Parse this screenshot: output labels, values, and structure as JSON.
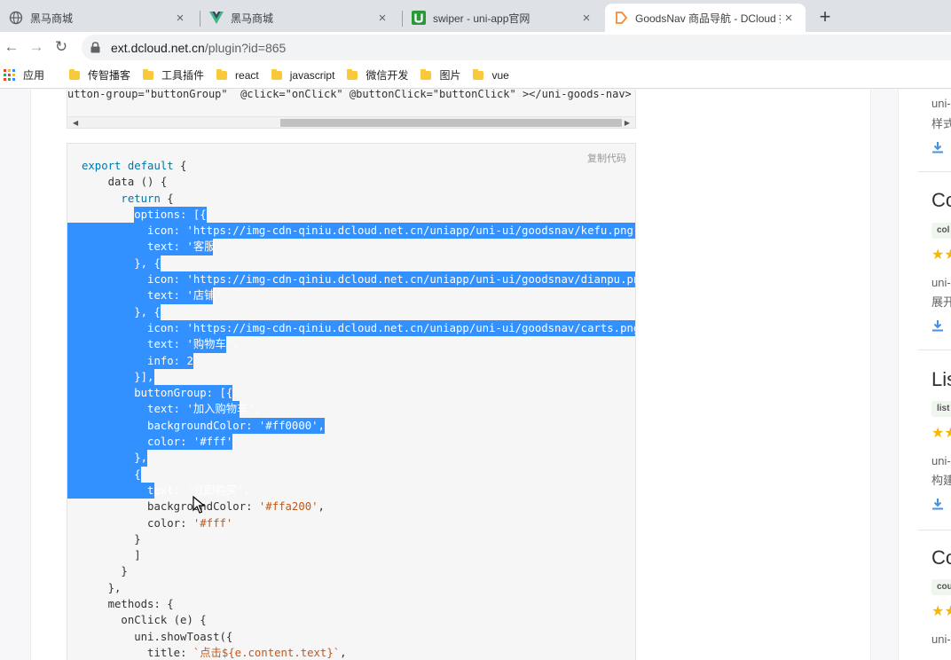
{
  "tabs": [
    {
      "title": "黑马商城",
      "icon": "globe-icon",
      "close": "×"
    },
    {
      "title": "黑马商城",
      "icon": "vue-logo-icon",
      "close": "×"
    },
    {
      "title": "swiper - uni-app官网",
      "icon": "uni-app-logo-icon",
      "close": "×"
    },
    {
      "title": "GoodsNav 商品导航 - DCloud 插",
      "icon": "dcloud-logo-icon",
      "close": "×"
    }
  ],
  "new_tab": "+",
  "toolbar": {
    "back": "←",
    "forward": "→",
    "reload": "↻",
    "url_host": "ext.dcloud.net.cn",
    "url_path": "/plugin?id=865"
  },
  "bookmarks": {
    "apps": "应用",
    "items": [
      "传智播客",
      "工具插件",
      "react",
      "javascript",
      "微信开发",
      "图片",
      "vue"
    ]
  },
  "top_code_line": "utton-group=\"buttonGroup\"  @click=\"onClick\" @buttonClick=\"buttonClick\" ></uni-goods-nav>",
  "scroll": {
    "left": "◀",
    "right": "▶"
  },
  "copy_label": "复制代码",
  "code_lines": [
    {
      "indent": "",
      "text": "export default {"
    },
    {
      "indent": "    ",
      "text": "data () {"
    },
    {
      "indent": "      ",
      "text": "return {"
    },
    {
      "indent": "        ",
      "text": "options: [{"
    },
    {
      "indent": "          ",
      "text": "icon: 'https://img-cdn-qiniu.dcloud.net.cn/uniapp/uni-ui/goodsnav/kefu.png',"
    },
    {
      "indent": "          ",
      "text": "text: '客服'"
    },
    {
      "indent": "        ",
      "text": "}, {"
    },
    {
      "indent": "          ",
      "text": "icon: 'https://img-cdn-qiniu.dcloud.net.cn/uniapp/uni-ui/goodsnav/dianpu.png',"
    },
    {
      "indent": "          ",
      "text": "text: '店铺'"
    },
    {
      "indent": "        ",
      "text": "}, {"
    },
    {
      "indent": "          ",
      "text": "icon: 'https://img-cdn-qiniu.dcloud.net.cn/uniapp/uni-ui/goodsnav/carts.png',"
    },
    {
      "indent": "          ",
      "text": "text: '购物车',"
    },
    {
      "indent": "          ",
      "text": "info: 2"
    },
    {
      "indent": "        ",
      "text": "}],"
    },
    {
      "indent": "        ",
      "text": "buttonGroup: [{"
    },
    {
      "indent": "          ",
      "text": "text: '加入购物车',"
    },
    {
      "indent": "          ",
      "text": "backgroundColor: '#ff0000',"
    },
    {
      "indent": "          ",
      "text": "color: '#fff'"
    },
    {
      "indent": "        ",
      "text": "},"
    },
    {
      "indent": "        ",
      "text": "{"
    },
    {
      "indent": "          ",
      "text": "text: '立即购买',"
    },
    {
      "indent": "          ",
      "text": "backgroundColor: '#ffa200',"
    },
    {
      "indent": "          ",
      "text": "color: '#fff'"
    },
    {
      "indent": "        ",
      "text": "}"
    },
    {
      "indent": "        ",
      "text": "]"
    },
    {
      "indent": "      ",
      "text": "}"
    },
    {
      "indent": "    ",
      "text": "},"
    },
    {
      "indent": "    ",
      "text": "methods: {"
    },
    {
      "indent": "      ",
      "text": "onClick (e) {"
    },
    {
      "indent": "        ",
      "text": "uni.showToast({"
    },
    {
      "indent": "          ",
      "text": "title: `点击${e.content.text}`,"
    }
  ],
  "selection": {
    "first_line": 3,
    "last_line": 20,
    "color": "#3390ff"
  },
  "sidebar": {
    "cards": [
      {
        "desc1": "uni-",
        "desc2": "样式"
      },
      {
        "title": "Co",
        "tag": "col",
        "stars": "★★",
        "desc1": "uni-",
        "desc2": "展开"
      },
      {
        "title": "Lis",
        "tag": "list",
        "stars": "★★",
        "desc1": "uni-",
        "desc2": "构建"
      },
      {
        "title": "Co",
        "tag": "cou",
        "stars": "★★",
        "desc1": "uni-"
      }
    ]
  },
  "colors": {
    "accent": "#3390ff",
    "link": "#4a90e2",
    "star": "#f5b800"
  }
}
